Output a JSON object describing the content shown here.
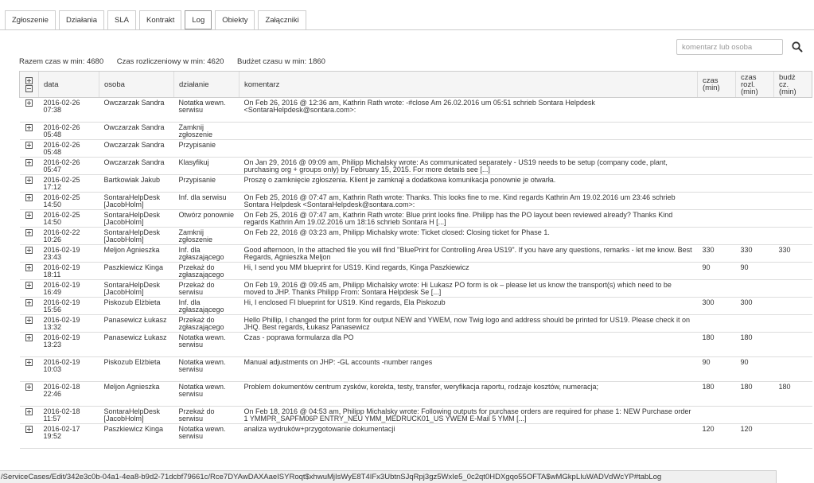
{
  "tabs": [
    {
      "label": "Zgłoszenie",
      "active": false
    },
    {
      "label": "Działania",
      "active": false
    },
    {
      "label": "SLA",
      "active": false
    },
    {
      "label": "Kontrakt",
      "active": false
    },
    {
      "label": "Log",
      "active": true
    },
    {
      "label": "Obiekty",
      "active": false
    },
    {
      "label": "Załączniki",
      "active": false
    }
  ],
  "search": {
    "placeholder": "komentarz lub osoba",
    "icon": "search-icon"
  },
  "summary": {
    "total": "Razem czas w min: 4680",
    "billed": "Czas rozliczeniowy w min: 4620",
    "budget": "Budżet czasu w min: 1860"
  },
  "columns": {
    "data": "data",
    "osoba": "osoba",
    "dzialanie": "działanie",
    "komentarz": "komentarz",
    "czas": "czas (min)",
    "czas_rozl": "czas rozl. (min)",
    "budz": "budż cz. (min)"
  },
  "rows": [
    {
      "data": "2016-02-26 07:38",
      "osoba": "Owczarzak Sandra",
      "dzialanie": "Notatka wewn. serwisu",
      "komentarz": "On Feb 26, 2016 @ 12:36 am, Kathrin Rath wrote: -#close Am 26.02.2016 um 05:51 schrieb Sontara Helpdesk <SontaraHelpdesk@sontara.com>:",
      "czas": "",
      "czas_rozl": "",
      "budz": ""
    },
    {
      "data": "2016-02-26 05:48",
      "osoba": "Owczarzak Sandra",
      "dzialanie": "Zamknij zgłoszenie",
      "komentarz": "",
      "czas": "",
      "czas_rozl": "",
      "budz": ""
    },
    {
      "data": "2016-02-26 05:48",
      "osoba": "Owczarzak Sandra",
      "dzialanie": "Przypisanie",
      "komentarz": "",
      "czas": "",
      "czas_rozl": "",
      "budz": ""
    },
    {
      "data": "2016-02-26 05:47",
      "osoba": "Owczarzak Sandra",
      "dzialanie": "Klasyfikuj",
      "komentarz": "On Jan 29, 2016 @ 09:09 am, Philipp Michalsky wrote: As communicated separately - US19 needs to be setup (company code, plant, purchasing org + groups only) by February 15, 2015. For more details see [...]",
      "czas": "",
      "czas_rozl": "",
      "budz": ""
    },
    {
      "data": "2016-02-25 17:12",
      "osoba": "Bartkowiak Jakub",
      "dzialanie": "Przypisanie",
      "komentarz": "Proszę o zamknięcie zgłoszenia. Klient je zamknął a dodatkowa komunikacja ponownie je otwarła.",
      "czas": "",
      "czas_rozl": "",
      "budz": ""
    },
    {
      "data": "2016-02-25 14:50",
      "osoba": "SontaraHelpDesk [JacobHolm]",
      "dzialanie": "Inf. dla serwisu",
      "komentarz": "On Feb 25, 2016 @ 07:47 am, Kathrin Rath wrote: Thanks. This looks fine to me. Kind regards Kathrin Am 19.02.2016 um 23:46 schrieb Sontara Helpdesk <SontaraHelpdesk@sontara.com>:",
      "czas": "",
      "czas_rozl": "",
      "budz": ""
    },
    {
      "data": "2016-02-25 14:50",
      "osoba": "SontaraHelpDesk [JacobHolm]",
      "dzialanie": "Otwórz ponownie",
      "komentarz": "On Feb 25, 2016 @ 07:47 am, Kathrin Rath wrote: Blue print looks fine. Philipp has the PO layout been reviewed already? Thanks Kind regards Kathrin Am 19.02.2016 um 18:16 schrieb Sontara H [...]",
      "czas": "",
      "czas_rozl": "",
      "budz": ""
    },
    {
      "data": "2016-02-22 10:26",
      "osoba": "SontaraHelpDesk [JacobHolm]",
      "dzialanie": "Zamknij zgłoszenie",
      "komentarz": "On Feb 22, 2016 @ 03:23 am, Philipp Michalsky wrote: Ticket closed: Closing ticket for Phase 1.",
      "czas": "",
      "czas_rozl": "",
      "budz": ""
    },
    {
      "data": "2016-02-19 23:43",
      "osoba": "Meljon Agnieszka",
      "dzialanie": "Inf. dla zgłaszającego",
      "komentarz": "Good afternoon, In the attached file you will find \"BluePrint for Controlling Area US19\". If you have any questions, remarks - let me know. Best Regards, Agnieszka Meljon",
      "czas": "330",
      "czas_rozl": "330",
      "budz": "330"
    },
    {
      "data": "2016-02-19 18:11",
      "osoba": "Paszkiewicz Kinga",
      "dzialanie": "Przekaż do zgłaszającego",
      "komentarz": "Hi, I send you MM blueprint for US19. Kind regards, Kinga Paszkiewicz",
      "czas": "90",
      "czas_rozl": "90",
      "budz": ""
    },
    {
      "data": "2016-02-19 16:49",
      "osoba": "SontaraHelpDesk [JacobHolm]",
      "dzialanie": "Przekaż do serwisu",
      "komentarz": "On Feb 19, 2016 @ 09:45 am, Philipp Michalsky wrote: Hi Lukasz PO form is ok – please let us know the transport(s) which need to be moved to JHP. Thanks Philipp From: Sontara Helpdesk Se [...]",
      "czas": "",
      "czas_rozl": "",
      "budz": ""
    },
    {
      "data": "2016-02-19 15:56",
      "osoba": "Piskozub Elżbieta",
      "dzialanie": "Inf. dla zgłaszającego",
      "komentarz": "Hi, I enclosed FI blueprint for US19. Kind regards, Ela Piskozub",
      "czas": "300",
      "czas_rozl": "300",
      "budz": ""
    },
    {
      "data": "2016-02-19 13:32",
      "osoba": "Panasewicz Łukasz",
      "dzialanie": "Przekaż do zgłaszającego",
      "komentarz": "Hello Phillip, I changed the print form for output NEW and YWEM, now Twig logo and address should be printed for US19. Please check it on JHQ. Best regards, Łukasz Panasewicz",
      "czas": "",
      "czas_rozl": "",
      "budz": ""
    },
    {
      "data": "2016-02-19 13:23",
      "osoba": "Panasewicz Łukasz",
      "dzialanie": "Notatka wewn. serwisu",
      "komentarz": "Czas - poprawa formularza dla PO",
      "czas": "180",
      "czas_rozl": "180",
      "budz": ""
    },
    {
      "data": "2016-02-19 10:03",
      "osoba": "Piskozub Elżbieta",
      "dzialanie": "Notatka wewn. serwisu",
      "komentarz": "Manual adjustments on JHP: -GL accounts -number ranges",
      "czas": "90",
      "czas_rozl": "90",
      "budz": ""
    },
    {
      "data": "2016-02-18 22:46",
      "osoba": "Meljon Agnieszka",
      "dzialanie": "Notatka wewn. serwisu",
      "komentarz": "Problem dokumentów centrum zysków, korekta, testy, transfer, weryfikacja raportu, rodzaje kosztów, numeracja;",
      "czas": "180",
      "czas_rozl": "180",
      "budz": "180"
    },
    {
      "data": "2016-02-18 11:57",
      "osoba": "SontaraHelpDesk [JacobHolm]",
      "dzialanie": "Przekaż do serwisu",
      "komentarz": "On Feb 18, 2016 @ 04:53 am, Philipp Michalsky wrote: Following outputs for purchase orders are required for phase 1: NEW Purchase order 1 YMMPR_SAPFM06P ENTRY_NEU YMM_MEDRUCK01_US YWEM E-Mail 5 YMM [...]",
      "czas": "",
      "czas_rozl": "",
      "budz": ""
    },
    {
      "data": "2016-02-17 19:52",
      "osoba": "Paszkiewicz Kinga",
      "dzialanie": "Notatka wewn. serwisu",
      "komentarz": "analiza wydruków+przygotowanie dokumentacji",
      "czas": "120",
      "czas_rozl": "120",
      "budz": ""
    }
  ],
  "statusbar": {
    "url": "/ServiceCases/Edit/342e3c0b-04a1-4ea8-b9d2-71dcbf79661c/Rce7DYAwDAXAaeISYRoqt$xhwuMjIsWyE8T4IFx3UbtnSJqRpj3gz5WxIe5_0c2qt0HDXgqo55OFTA$wMGkpLIuWADVdWcYP#tabLog"
  }
}
